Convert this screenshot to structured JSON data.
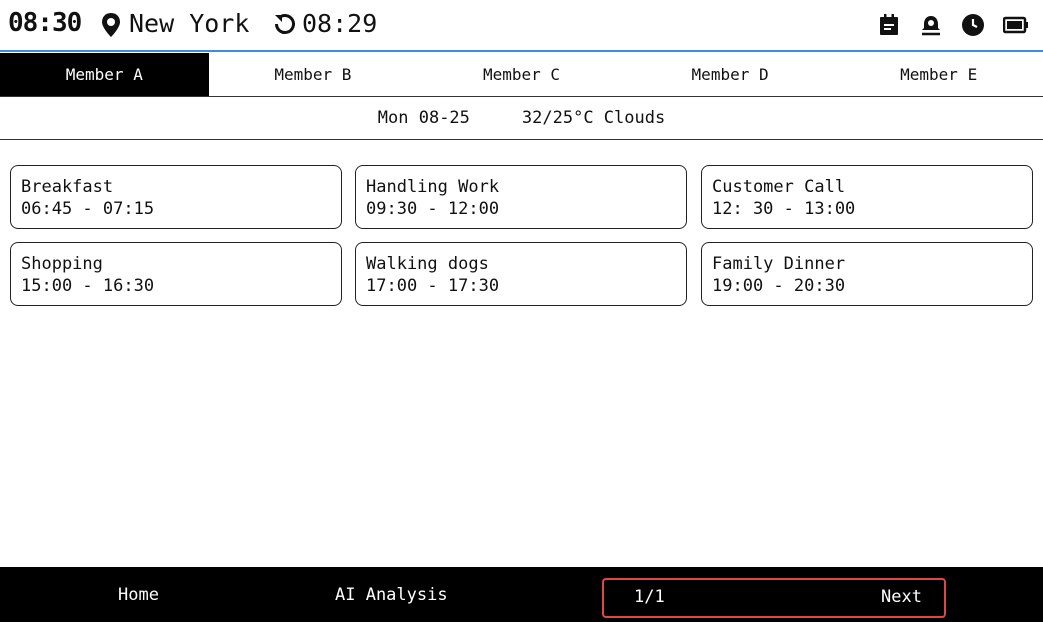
{
  "status": {
    "clock": "08:30",
    "location": "New York",
    "sync_time": "08:29",
    "icons": [
      "calendar-icon",
      "alarm-icon",
      "clock-icon",
      "battery-icon"
    ]
  },
  "tabs": [
    {
      "label": "Member A",
      "active": true
    },
    {
      "label": "Member B",
      "active": false
    },
    {
      "label": "Member C",
      "active": false
    },
    {
      "label": "Member D",
      "active": false
    },
    {
      "label": "Member E",
      "active": false
    }
  ],
  "info": {
    "date": "Mon 08-25",
    "weather": "32/25°C Clouds"
  },
  "events": [
    {
      "title": "Breakfast",
      "time": "06:45 - 07:15"
    },
    {
      "title": "Handling Work",
      "time": "09:30 - 12:00"
    },
    {
      "title": "Customer Call",
      "time": "12: 30 - 13:00"
    },
    {
      "title": "Shopping",
      "time": "15:00 - 16:30"
    },
    {
      "title": "Walking dogs",
      "time": "17:00 - 17:30"
    },
    {
      "title": "Family Dinner",
      "time": "19:00 - 20:30"
    }
  ],
  "bottom": {
    "home": "Home",
    "ai": "AI Analysis",
    "page": "1/1",
    "next": "Next"
  },
  "colors": {
    "accent_line": "#3b8fd9",
    "highlight_border": "#e04848"
  }
}
